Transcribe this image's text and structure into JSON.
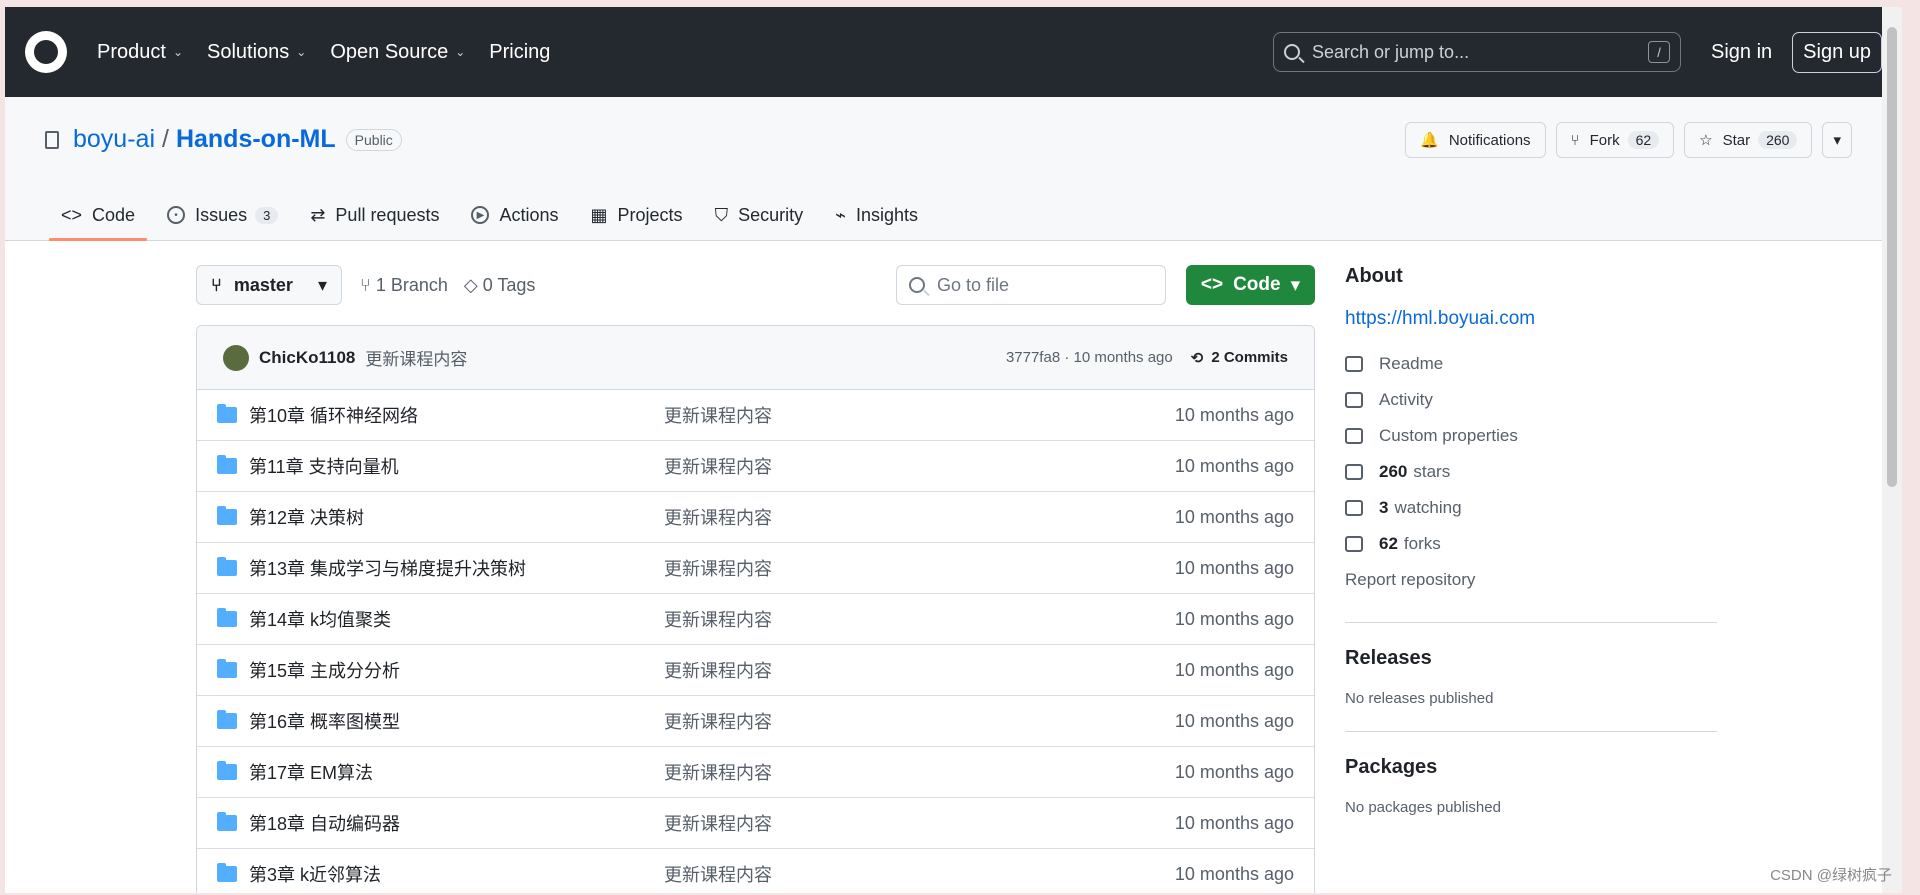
{
  "topnav": {
    "items": [
      {
        "label": "Product"
      },
      {
        "label": "Solutions"
      },
      {
        "label": "Open Source"
      },
      {
        "label": "Pricing"
      }
    ],
    "search_placeholder": "Search or jump to...",
    "shortcut": "/",
    "signin": "Sign in",
    "signup": "Sign up"
  },
  "repo": {
    "owner": "boyu-ai",
    "name": "Hands-on-ML",
    "visibility": "Public",
    "notifications": "Notifications",
    "fork_label": "Fork",
    "fork_count": "62",
    "star_label": "Star",
    "star_count": "260"
  },
  "tabs": [
    {
      "label": "Code"
    },
    {
      "label": "Issues",
      "count": "3"
    },
    {
      "label": "Pull requests"
    },
    {
      "label": "Actions"
    },
    {
      "label": "Projects"
    },
    {
      "label": "Security"
    },
    {
      "label": "Insights"
    }
  ],
  "toolbar": {
    "branch": "master",
    "branches": "1 Branch",
    "tags": "0 Tags",
    "goto": "Go to file",
    "code": "Code"
  },
  "commit": {
    "author": "ChicKo1108",
    "message": "更新课程内容",
    "hash": "3777fa8 · 10 months ago",
    "commits": "2 Commits"
  },
  "files": [
    {
      "name": "第10章 循环神经网络",
      "message": "更新课程内容",
      "date": "10 months ago"
    },
    {
      "name": "第11章 支持向量机",
      "message": "更新课程内容",
      "date": "10 months ago"
    },
    {
      "name": "第12章 决策树",
      "message": "更新课程内容",
      "date": "10 months ago"
    },
    {
      "name": "第13章 集成学习与梯度提升决策树",
      "message": "更新课程内容",
      "date": "10 months ago"
    },
    {
      "name": "第14章 k均值聚类",
      "message": "更新课程内容",
      "date": "10 months ago"
    },
    {
      "name": "第15章 主成分分析",
      "message": "更新课程内容",
      "date": "10 months ago"
    },
    {
      "name": "第16章 概率图模型",
      "message": "更新课程内容",
      "date": "10 months ago"
    },
    {
      "name": "第17章 EM算法",
      "message": "更新课程内容",
      "date": "10 months ago"
    },
    {
      "name": "第18章 自动编码器",
      "message": "更新课程内容",
      "date": "10 months ago"
    },
    {
      "name": "第3章 k近邻算法",
      "message": "更新课程内容",
      "date": "10 months ago"
    }
  ],
  "about": {
    "heading": "About",
    "link": "https://hml.boyuai.com",
    "readme": "Readme",
    "activity": "Activity",
    "custom": "Custom properties",
    "stars_count": "260",
    "stars_label": "stars",
    "watching_count": "3",
    "watching_label": "watching",
    "forks_count": "62",
    "forks_label": "forks",
    "report": "Report repository"
  },
  "releases": {
    "heading": "Releases",
    "text": "No releases published"
  },
  "packages": {
    "heading": "Packages",
    "text": "No packages published"
  },
  "watermark": "CSDN @绿树疯子"
}
